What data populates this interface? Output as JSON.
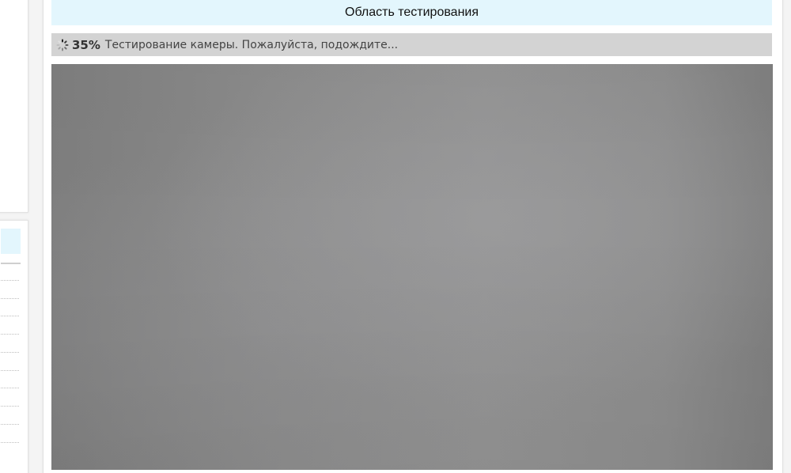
{
  "title_bar": {
    "title": "Область тестирования"
  },
  "status": {
    "progress_percent_label": "35%",
    "progress_value": 0.35,
    "message": "Тестирование камеры. Пожалуйста, подождите...",
    "spinner_icon": "loading-spinner-icon"
  },
  "camera": {
    "feed": "webcam-preview"
  },
  "colors": {
    "title_bar_bg": "#e3f6fd",
    "status_bar_bg": "#d3d3d3",
    "camera_gray": "#8c8c8c",
    "page_bg": "#f4f4f4"
  }
}
